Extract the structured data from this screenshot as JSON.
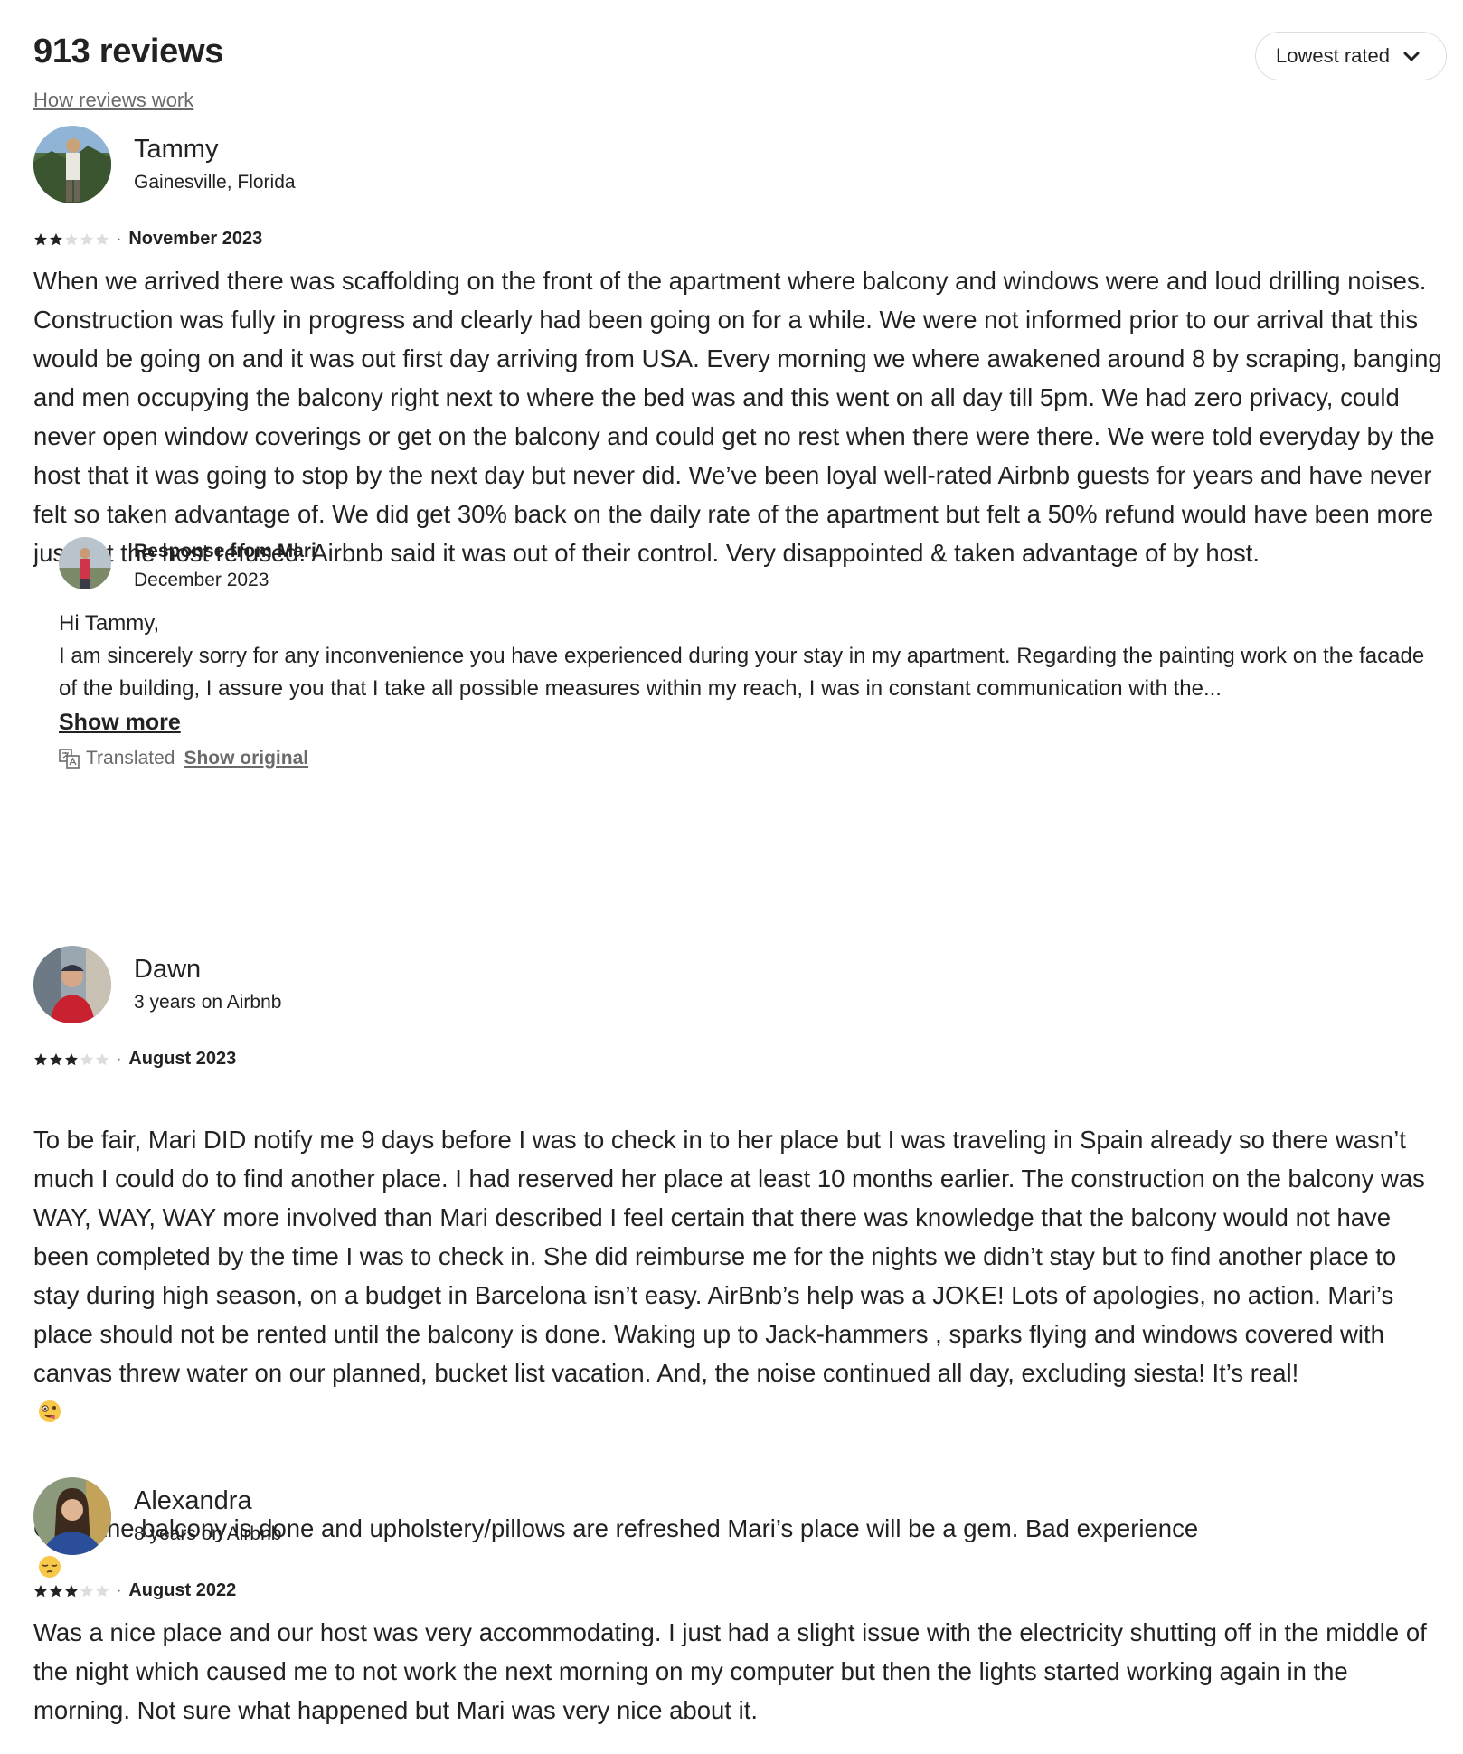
{
  "header": {
    "count_title": "913 reviews",
    "how_reviews_work": "How reviews work",
    "sort_label": "Lowest rated"
  },
  "colors": {
    "text": "#222222",
    "muted": "#6a6a6a",
    "border": "#dddddd",
    "star_filled": "#222222",
    "star_empty": "#dddddd"
  },
  "reviews": [
    {
      "name": "Tammy",
      "sub": "Gainesville, Florida",
      "rating": 2,
      "date": "November 2023",
      "text": "When we arrived there was scaffolding on the front of the apartment where balcony and windows were and loud drilling noises. Construction was fully in progress and clearly had been going on for a while.  We were not informed prior to our arrival that this would be going on and it was out first day arriving from USA. Every morning we where awakened around 8 by scraping, banging and men occupying the balcony right next to where the bed was and this went on all day till 5pm.  We had zero privacy, could never open window coverings or get on the balcony and could get no rest when there were there. We were told everyday by the host that it was going to stop by the next day but never did. We’ve been loyal well-rated Airbnb guests for years and have never felt so taken advantage of. We did get 30% back on the daily rate of the apartment but felt a 50% refund would have been more just but the host refused. Airbnb said it was out of their control. Very disappointed & taken advantage of by host.",
      "response": {
        "title": "Response from Mari",
        "date": "December 2023",
        "greeting": "Hi Tammy,",
        "text": "I am sincerely sorry for any inconvenience you have experienced during your stay in my apartment. Regarding the painting work on the facade of the building, I assure you that I take all possible measures within my reach, I was in constant communication with the...",
        "show_more": "Show more",
        "translated": "Translated",
        "show_original": "Show original"
      }
    },
    {
      "name": "Dawn",
      "sub": "3 years on Airbnb",
      "rating": 3,
      "date": "August 2023",
      "text_main": "To be fair, Mari DID notify me 9 days before I was to check in to her place but I was traveling in Spain already so there wasn’t much I could do to find another place.  I had reserved her place at least 10 months earlier.   The construction on the balcony was WAY, WAY, WAY more involved than Mari described   I feel certain that there was knowledge that the balcony would not have been completed by the time I was to check in.  She did reimburse me for the nights we didn’t stay but to find another place to stay during high season, on a  budget in Barcelona isn’t easy.  AirBnb’s help was a JOKE!  Lots of apologies, no action.  Mari’s place should not  be  rented until the balcony is done.  Waking up to Jack-hammers , sparks flying and windows covered with canvas threw water on our planned, bucket list vacation.  And, the noise continued all day, excluding siesta!  It’s real!",
      "text_last": "Once the balcony is done and upholstery/pillows are refreshed Mari’s place will be a gem.  Bad experience",
      "emoji_1": "zany-face-emoji",
      "emoji_2": "pensive-face-emoji"
    },
    {
      "name": "Alexandra",
      "sub": "8 years on Airbnb",
      "rating": 3,
      "date": "August 2022",
      "text": "Was a nice place and our host was very accommodating. I just had a slight issue with the electricity shutting off in the middle of the night which caused me to not work the next morning on my computer but then the lights started working again in the morning. Not sure what happened but Mari was very nice about it."
    }
  ]
}
